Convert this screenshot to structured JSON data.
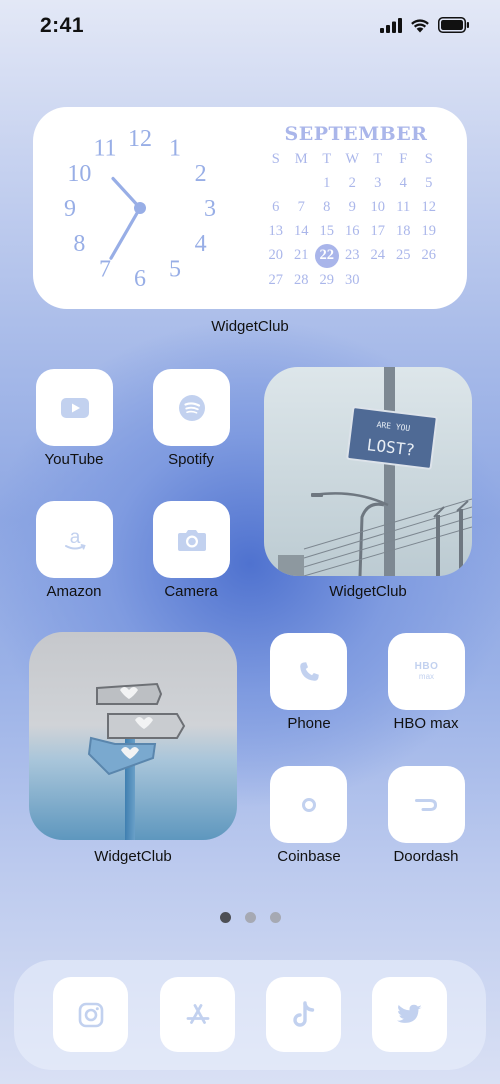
{
  "status_bar": {
    "time": "2:41"
  },
  "calendar_widget": {
    "month": "SEPTEMBER",
    "weekdays": [
      "S",
      "M",
      "T",
      "W",
      "T",
      "F",
      "S"
    ],
    "cells": [
      "",
      "",
      "1",
      "2",
      "3",
      "4",
      "5",
      "6",
      "7",
      "8",
      "9",
      "10",
      "11",
      "12",
      "13",
      "14",
      "15",
      "16",
      "17",
      "18",
      "19",
      "20",
      "21",
      "22",
      "23",
      "24",
      "25",
      "26",
      "27",
      "28",
      "29",
      "30"
    ],
    "today": "22",
    "label": "WidgetClub",
    "clock": {
      "numerals": [
        "12",
        "1",
        "2",
        "3",
        "4",
        "5",
        "6",
        "7",
        "8",
        "9",
        "10",
        "11"
      ],
      "time": "10:35"
    }
  },
  "apps": {
    "youtube": {
      "label": "YouTube",
      "icon": "youtube-icon"
    },
    "spotify": {
      "label": "Spotify",
      "icon": "spotify-icon"
    },
    "amazon": {
      "label": "Amazon",
      "icon": "amazon-icon"
    },
    "camera": {
      "label": "Camera",
      "icon": "camera-icon"
    },
    "phone": {
      "label": "Phone",
      "icon": "phone-icon"
    },
    "hbo": {
      "label": "HBO max",
      "icon": "hbo-max-icon",
      "logo_top": "HBO",
      "logo_bottom": "max"
    },
    "coinbase": {
      "label": "Coinbase",
      "icon": "coinbase-icon"
    },
    "doordash": {
      "label": "Doordash",
      "icon": "doordash-icon"
    }
  },
  "photo_widgets": {
    "lost": {
      "label": "WidgetClub",
      "sign_top": "ARE YOU",
      "sign_bottom": "LOST?"
    },
    "signpost": {
      "label": "WidgetClub"
    }
  },
  "page_dots": {
    "count": 3,
    "active": 1
  },
  "dock": [
    {
      "icon": "instagram-icon"
    },
    {
      "icon": "app-store-icon"
    },
    {
      "icon": "tiktok-icon"
    },
    {
      "icon": "twitter-icon"
    }
  ],
  "colors": {
    "icon_tint": "#c2d1ef",
    "calendar_accent": "#aab6ea",
    "clock_hands": "#98aee6"
  }
}
